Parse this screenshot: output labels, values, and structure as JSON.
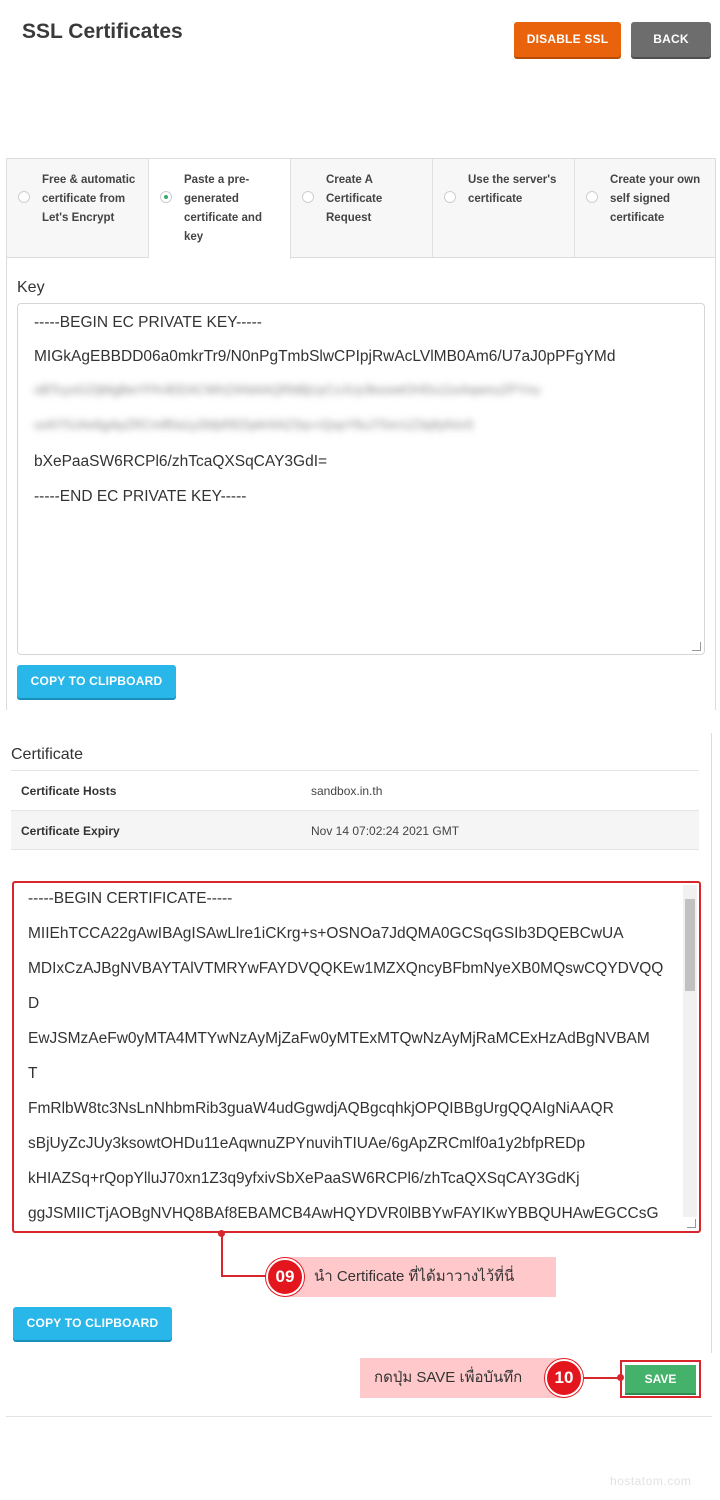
{
  "header": {
    "title": "SSL Certificates",
    "disable_label": "DISABLE SSL",
    "back_label": "BACK"
  },
  "tabs": [
    {
      "label": "Free & automatic certificate from Let's Encrypt",
      "selected": false
    },
    {
      "label": "Paste a pre-generated certificate and key",
      "selected": true
    },
    {
      "label": "Create A Certificate Request",
      "selected": false
    },
    {
      "label": "Use the server's certificate",
      "selected": false
    },
    {
      "label": "Create your own self signed certificate",
      "selected": false
    }
  ],
  "key": {
    "label": "Key",
    "lines": [
      "-----BEGIN EC PRIVATE KEY-----",
      "MIGkAgEBBDD06a0mkrTr9/N0nPgTmbSlwCPIpjRwAcLVlMB0Am6/U7aJ0pPFgYMd",
      "oBTcyoGZIjMgBwYFK4EEACWhZANiAAQRbBjUyCzJUy3ksowtOHDu11eAqwnuZPYnu",
      "uvihTIUAe6gApZRCmlf0a1y2bfpREDpkHIAZSq+rQopYlluJ70xn1Z3q9yfxivS",
      "bXePaaSW6RCPl6/zhTcaQXSqCAY3GdI=",
      "-----END EC PRIVATE KEY-----"
    ],
    "copy_label": "COPY TO CLIPBOARD"
  },
  "certificate": {
    "heading": "Certificate",
    "rows": [
      {
        "key": "Certificate Hosts",
        "value": "sandbox.in.th"
      },
      {
        "key": "Certificate Expiry",
        "value": "Nov 14 07:02:24 2021 GMT"
      }
    ],
    "lines": [
      "-----BEGIN CERTIFICATE-----",
      "MIIEhTCCA22gAwIBAgISAwLlre1iCKrg+s+OSNOa7JdQMA0GCSqGSIb3DQEBCwUA",
      "MDIxCzAJBgNVBAYTAlVTMRYwFAYDVQQKEw1MZXQncyBFbmNyeXB0MQswCQYDVQQ",
      "D",
      "EwJSMzAeFw0yMTA4MTYwNzAyMjZaFw0yMTExMTQwNzAyMjRaMCExHzAdBgNVBAM",
      "T",
      "FmRlbW8tc3NsLnNhbmRib3guaW4udGgwdjAQBgcqhkjOPQIBBgUrgQQAIgNiAAQR",
      "sBjUyZcJUy3ksowtOHDu11eAqwnuZPYnuvihTIUAe/6gApZRCmlf0a1y2bfpREDp",
      "kHIAZSq+rQopYlluJ70xn1Z3q9yfxivSbXePaaSW6RCPl6/zhTcaQXSqCAY3GdKj",
      "ggJSMIICTjAOBgNVHQ8BAf8EBAMCB4AwHQYDVR0lBBYwFAYIKwYBBQUHAwEGCCsG"
    ],
    "copy_label": "COPY TO CLIPBOARD"
  },
  "annotations": {
    "step9_number": "09",
    "step9_text": "นำ Certificate ที่ได้มาวางไว้ที่นี่",
    "step10_number": "10",
    "step10_text": "กดปุ่ม SAVE เพื่อบันทึก"
  },
  "save_label": "SAVE",
  "watermark": "hostatom.com",
  "colors": {
    "disable": "#e8630b",
    "back": "#6d6d6d",
    "copy": "#29b6e8",
    "save": "#45b26b",
    "highlight": "#d9262c",
    "callout_bg": "#ffc9cc"
  }
}
